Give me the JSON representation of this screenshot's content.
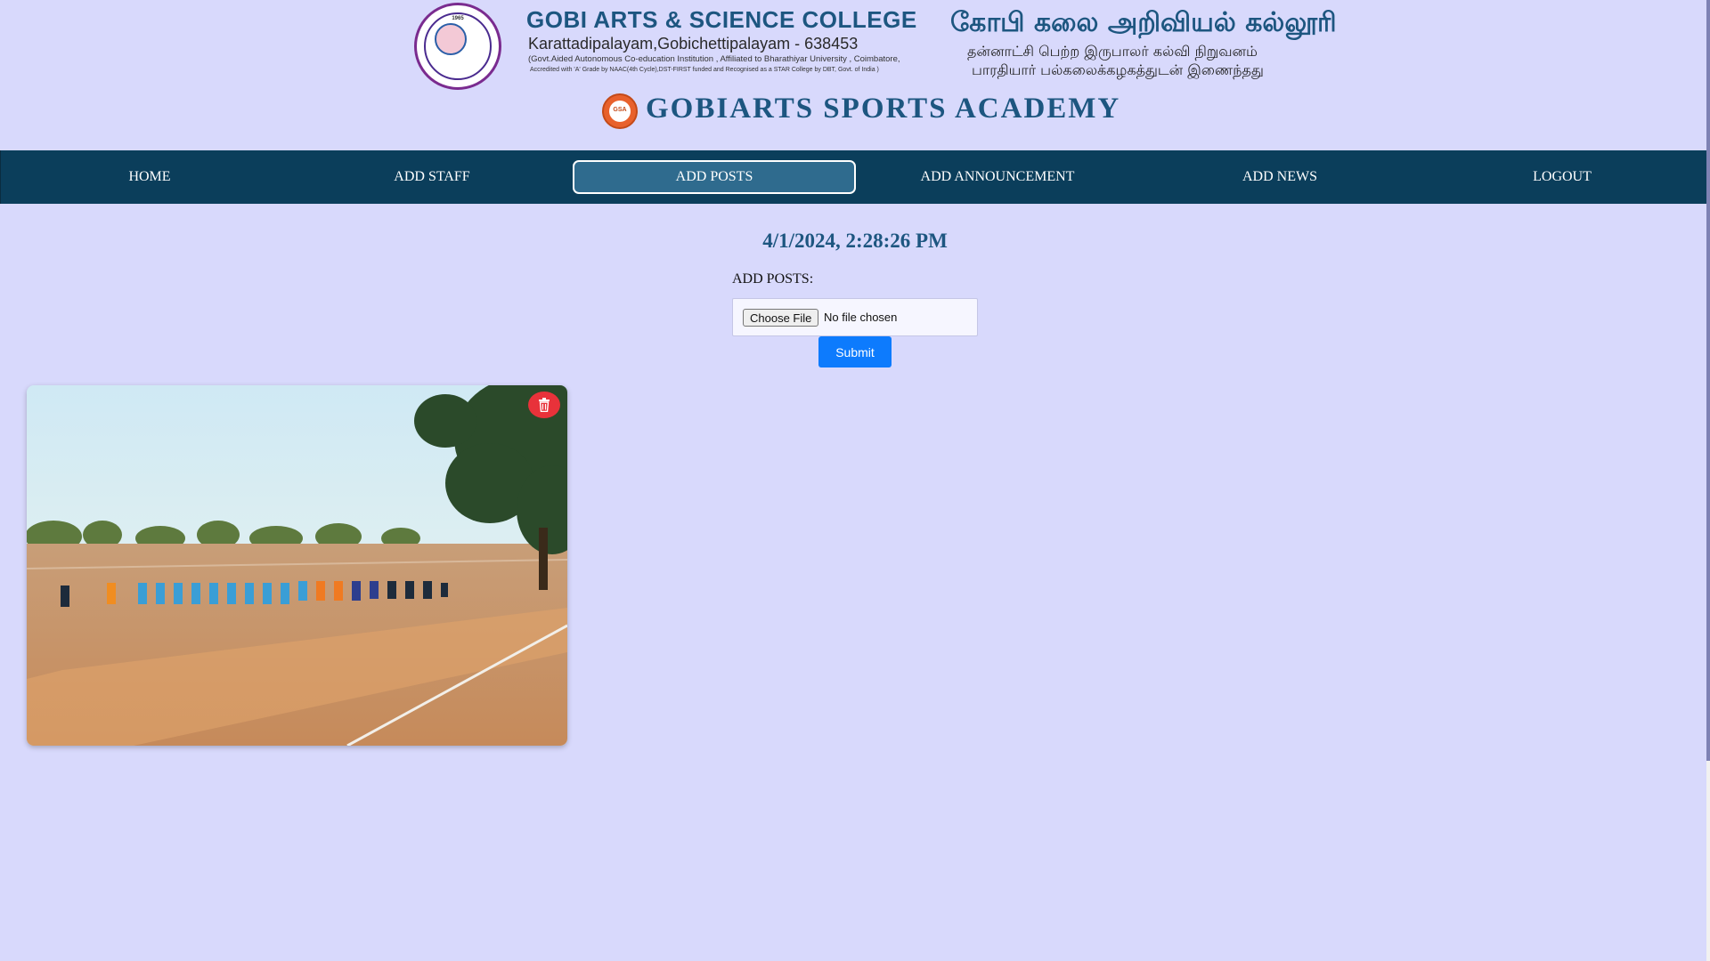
{
  "header": {
    "college_name": "GOBI ARTS & SCIENCE COLLEGE",
    "address": "Karattadipalayam,Gobichettipalayam - 638453",
    "line1": "(Govt.Aided Autonomous Co-education Institution , Affiliated to Bharathiyar University , Coimbatore,",
    "line2": "Accredited with 'A' Grade by NAAC(4th Cycle),DST-FIRST funded and Recognised as a STAR College by DBT, Govt. of India )",
    "tamil_name": "கோபி கலை அறிவியல் கல்லூரி",
    "tamil_line1": "தன்னாட்சி பெற்ற இருபாலர் கல்வி நிறுவனம்",
    "tamil_line2": "பாரதியார் பல்கலைக்கழகத்துடன் இணைந்தது",
    "seal_year": "1965",
    "academy_logo_text": "GSA",
    "academy_name": "GOBIARTS SPORTS ACADEMY"
  },
  "nav": {
    "items": [
      {
        "label": "HOME"
      },
      {
        "label": "ADD STAFF"
      },
      {
        "label": "ADD POSTS"
      },
      {
        "label": "ADD ANNOUNCEMENT"
      },
      {
        "label": "ADD NEWS"
      },
      {
        "label": "LOGOUT"
      }
    ],
    "active": "ADD POSTS"
  },
  "main": {
    "datetime": "4/1/2024, 2:28:26 PM",
    "form_label": "ADD POSTS:",
    "choose_file_label": "Choose File",
    "file_status": "No file chosen",
    "submit_label": "Submit"
  },
  "posts": [
    {
      "image": "athletes-running-on-track-photo",
      "delete_icon": "trash-icon"
    }
  ],
  "colors": {
    "background": "#d8d9fc",
    "nav_bg": "#0b3e5b",
    "brand_blue": "#1d5680",
    "submit_blue": "#0d7bfd",
    "delete_red": "#e8323a"
  }
}
